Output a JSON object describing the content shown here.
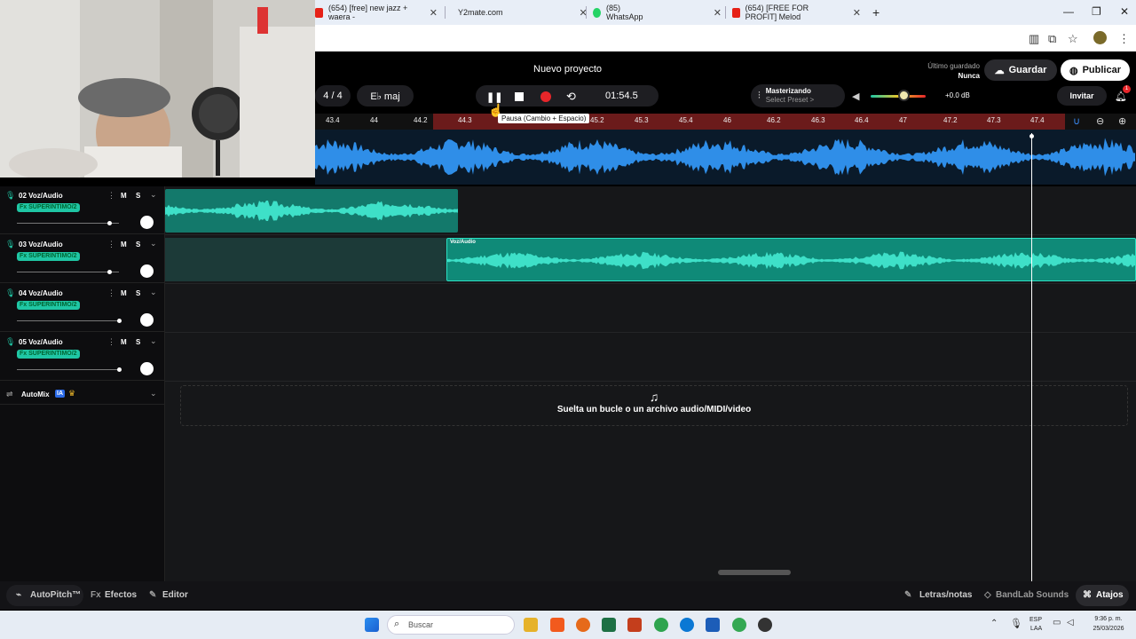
{
  "browser": {
    "tabs": [
      {
        "label": "(654) [free] new jazz + waera -",
        "color": "#e62117"
      },
      {
        "label": "Y2mate.com",
        "color": "#e33"
      },
      {
        "label": "(85) WhatsApp",
        "color": "#25d366"
      },
      {
        "label": "(654) [FREE FOR PROFIT] Melod",
        "color": "#e62117"
      }
    ],
    "new_tab": "+"
  },
  "header": {
    "title": "Nuevo proyecto",
    "time_signature": "4 / 4",
    "key": "E♭ maj",
    "time": "01:54.5",
    "mastering_label": "Masterizando",
    "mastering_preset": "Select Preset >",
    "volume_db": "+0.0 dB",
    "volume_level": 0.62,
    "last_saved_label": "Último guardado",
    "last_saved_value": "Nunca",
    "save": "Guardar",
    "publish": "Publicar",
    "invite": "Invitar",
    "notif_count": "1",
    "tooltip": "Pausa (Cambio + Espacio)"
  },
  "ruler": {
    "ticks": [
      "43.4",
      "44",
      "44.2",
      "44.3",
      "45.2",
      "45.3",
      "45.4",
      "46",
      "46.2",
      "46.3",
      "46.4",
      "47",
      "47.2",
      "47.3",
      "47.4"
    ]
  },
  "tracks": [
    {
      "name": "02  Voz/Audio",
      "fx": "Fx SUPERINTIMO/2",
      "m": "M",
      "s": "S",
      "level": 0.9
    },
    {
      "name": "03  Voz/Audio",
      "fx": "Fx SUPERINTIMO/2",
      "m": "M",
      "s": "S",
      "level": 0.9
    },
    {
      "name": "04  Voz/Audio",
      "fx": "Fx SUPERINTIMO/2",
      "m": "M",
      "s": "S",
      "level": 1.0
    },
    {
      "name": "05  Voz/Audio",
      "fx": "Fx SUPERINTIMO/2",
      "m": "M",
      "s": "S",
      "level": 1.0
    }
  ],
  "clip_label": "Voz/Audio",
  "automix": {
    "label": "AutoMix",
    "badge": "IA"
  },
  "dropzone": {
    "text": "Suelta un bucle o un archivo audio/MIDI/video"
  },
  "bottom": {
    "autopitch": "AutoPitch™",
    "effects": "Efectos",
    "editor": "Editor",
    "lyrics": "Letras/notas",
    "sounds": "BandLab Sounds",
    "shortcuts": "Atajos"
  },
  "taskbar": {
    "search": "Buscar",
    "lang1": "ESP",
    "lang2": "LAA",
    "time": "9:36 p. m.",
    "date": "25/03/2026"
  }
}
